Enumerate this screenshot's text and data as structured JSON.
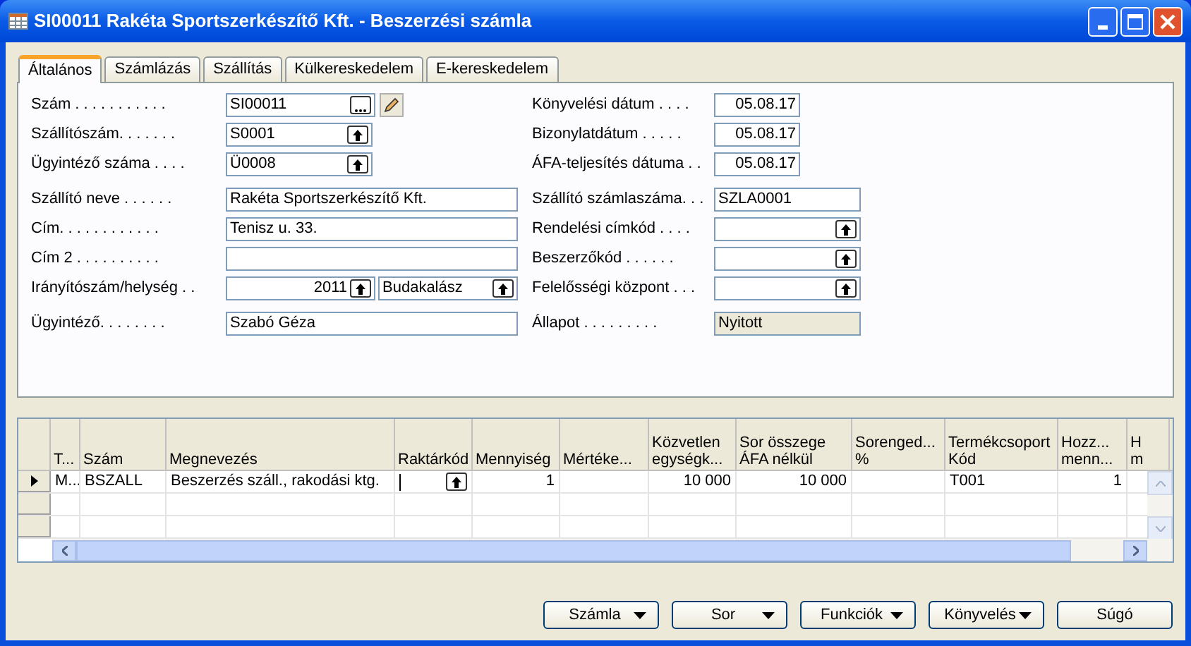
{
  "window": {
    "title": "SI00011 Rakéta Sportszerkészítő Kft. - Beszerzési számla"
  },
  "tabs": [
    {
      "label": "Általános",
      "selected": true
    },
    {
      "label": "Számlázás",
      "selected": false
    },
    {
      "label": "Szállítás",
      "selected": false
    },
    {
      "label": "Külkereskedelem",
      "selected": false
    },
    {
      "label": "E-kereskedelem",
      "selected": false
    }
  ],
  "left_fields": [
    {
      "label": "Szám . . . . . . . . . . .",
      "kind": "ellipsis",
      "value": "SI00011"
    },
    {
      "label": "Szállítószám. . . . . . .",
      "kind": "lookup",
      "value": "S0001"
    },
    {
      "label": "Ügyintéző száma . . . .",
      "kind": "lookup",
      "value": "Ü0008"
    },
    {
      "label": "Szállító neve . . . . . .",
      "kind": "text",
      "value": "Rakéta Sportszerkészítő Kft."
    },
    {
      "label": "Cím. . . . . . . . . . . .",
      "kind": "text",
      "value": "Tenisz u. 33."
    },
    {
      "label": "Cím 2 . . . . . . . . . .",
      "kind": "text"
    },
    {
      "label": "Irányítószám/helység . .",
      "kind": "postcode",
      "value": "2011",
      "value2": "Budakalász"
    },
    {
      "label": "Ügyintéző. . . . . . . .",
      "kind": "text",
      "value": "Szabó Géza"
    }
  ],
  "right_fields": [
    {
      "label": "Könyvelési dátum . . . .",
      "kind": "date",
      "value": "05.08.17"
    },
    {
      "label": "Bizonylatdátum . . . . .",
      "kind": "date",
      "value": "05.08.17"
    },
    {
      "label": "ÁFA-teljesítés dátuma . .",
      "kind": "date",
      "value": "05.08.17"
    },
    {
      "label": "Szállító számlaszáma. . .",
      "kind": "text",
      "value": "SZLA0001"
    },
    {
      "label": "Rendelési címkód . . . .",
      "kind": "lookup"
    },
    {
      "label": "Beszerzőkód . . . . . .",
      "kind": "lookup"
    },
    {
      "label": "Felelősségi központ . . .",
      "kind": "lookup"
    },
    {
      "label": "Állapot . . . . . . . . .",
      "kind": "readonly",
      "value": "Nyitott"
    }
  ],
  "lines": {
    "columns": [
      {
        "label": "T...",
        "kind": "text"
      },
      {
        "label": "Szám",
        "kind": "text"
      },
      {
        "label": "Megnevezés",
        "kind": "text"
      },
      {
        "label": "Raktárkód",
        "kind": "lookup"
      },
      {
        "label": "Mennyiség",
        "kind": "number"
      },
      {
        "label": "Mértéke...",
        "kind": "text"
      },
      {
        "label": "Közvetlen\negységk...",
        "kind": "number"
      },
      {
        "label": "Sor összege\nÁFA nélkül",
        "kind": "number"
      },
      {
        "label": "Sorenged...\n%",
        "kind": "number"
      },
      {
        "label": "Termékcsoport\nKód",
        "kind": "text"
      },
      {
        "label": "Hozz...\nmenn...",
        "kind": "number"
      },
      {
        "label": "H\nm",
        "kind": "number"
      }
    ],
    "rows": [
      {
        "selected": true,
        "cells": [
          "M...",
          "BSZALL",
          "Beszerzés száll., rakodási ktg.",
          null,
          "1",
          null,
          "10 000",
          "10 000",
          null,
          "T001",
          "1",
          null
        ]
      },
      {
        "selected": false
      },
      {
        "selected": false
      }
    ]
  },
  "buttons": [
    {
      "label": "Számla",
      "dropdown": true
    },
    {
      "label": "Sor",
      "dropdown": true
    },
    {
      "label": "Funkciók",
      "dropdown": true
    },
    {
      "label": "Könyvelés",
      "dropdown": true
    },
    {
      "label": "Súgó",
      "dropdown": false
    }
  ]
}
